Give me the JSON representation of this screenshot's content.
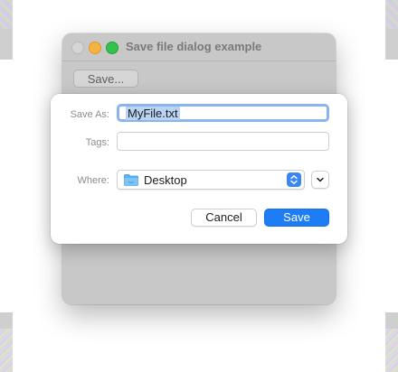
{
  "window": {
    "title": "Save file dialog example",
    "save_button_label": "Save..."
  },
  "dialog": {
    "save_as_label": "Save As:",
    "save_as_value": "MyFile.txt",
    "tags_label": "Tags:",
    "tags_value": "",
    "where_label": "Where:",
    "where_value": "Desktop",
    "where_icon": "folder-icon",
    "cancel_label": "Cancel",
    "save_label": "Save"
  },
  "colors": {
    "accent": "#1e7cf4",
    "selection": "#b9d3f4",
    "traffic_close": "#d5d5d5",
    "traffic_minimize": "#f5b33f",
    "traffic_maximize": "#33c24a"
  }
}
